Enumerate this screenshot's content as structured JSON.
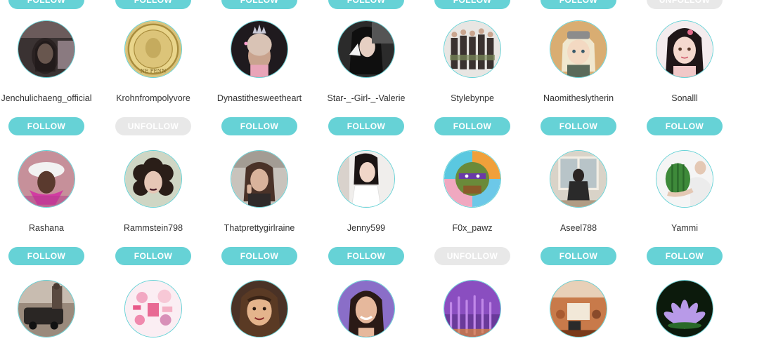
{
  "colors": {
    "accent": "#66d2d6",
    "muted": "#e8e8e8",
    "ring": "#66d2d6"
  },
  "top_row_buttons": [
    {
      "label": "FOLLOW",
      "state": "follow"
    },
    {
      "label": "FOLLOW",
      "state": "follow"
    },
    {
      "label": "FOLLOW",
      "state": "follow"
    },
    {
      "label": "FOLLOW",
      "state": "follow"
    },
    {
      "label": "FOLLOW",
      "state": "follow"
    },
    {
      "label": "FOLLOW",
      "state": "follow"
    },
    {
      "label": "UNFOLLOW",
      "state": "unfollow"
    }
  ],
  "rows": [
    [
      {
        "username": "Jenchulichaeng_official",
        "button": "FOLLOW",
        "state": "follow",
        "avatar": "selfie-dark"
      },
      {
        "username": "Krohnfrompolyvore",
        "button": "UNFOLLOW",
        "state": "unfollow",
        "avatar": "gold-coin"
      },
      {
        "username": "Dynastithesweetheart",
        "button": "FOLLOW",
        "state": "follow",
        "avatar": "crown-girl"
      },
      {
        "username": "Star-_-Girl-_-Valerie",
        "button": "FOLLOW",
        "state": "follow",
        "avatar": "dark-hair-girl"
      },
      {
        "username": "Stylebynpe",
        "button": "FOLLOW",
        "state": "follow",
        "avatar": "group-photo"
      },
      {
        "username": "Naomitheslytherin",
        "button": "FOLLOW",
        "state": "follow",
        "avatar": "cartoon-blonde"
      },
      {
        "username": "Sonalll",
        "button": "FOLLOW",
        "state": "follow",
        "avatar": "cartoon-girl"
      }
    ],
    [
      {
        "username": "Rashana",
        "button": "FOLLOW",
        "state": "follow",
        "avatar": "pink-hat"
      },
      {
        "username": "Rammstein798",
        "button": "FOLLOW",
        "state": "follow",
        "avatar": "curly-hair"
      },
      {
        "username": "Thatprettygirlraine",
        "button": "FOLLOW",
        "state": "follow",
        "avatar": "car-selfie"
      },
      {
        "username": "Jenny599",
        "button": "FOLLOW",
        "state": "follow",
        "avatar": "white-dress"
      },
      {
        "username": "F0x_pawz",
        "button": "UNFOLLOW",
        "state": "unfollow",
        "avatar": "turtle-flag"
      },
      {
        "username": "Aseel788",
        "button": "FOLLOW",
        "state": "follow",
        "avatar": "sitting-man"
      },
      {
        "username": "Yammi",
        "button": "FOLLOW",
        "state": "follow",
        "avatar": "watermelon"
      }
    ],
    [
      {
        "username": "",
        "avatar": "sepia-car"
      },
      {
        "username": "",
        "avatar": "pink-collage"
      },
      {
        "username": "",
        "avatar": "cartoon-brunette"
      },
      {
        "username": "",
        "avatar": "smiling-woman"
      },
      {
        "username": "",
        "avatar": "lavender-field"
      },
      {
        "username": "",
        "avatar": "cafe"
      },
      {
        "username": "",
        "avatar": "lotus"
      }
    ]
  ]
}
